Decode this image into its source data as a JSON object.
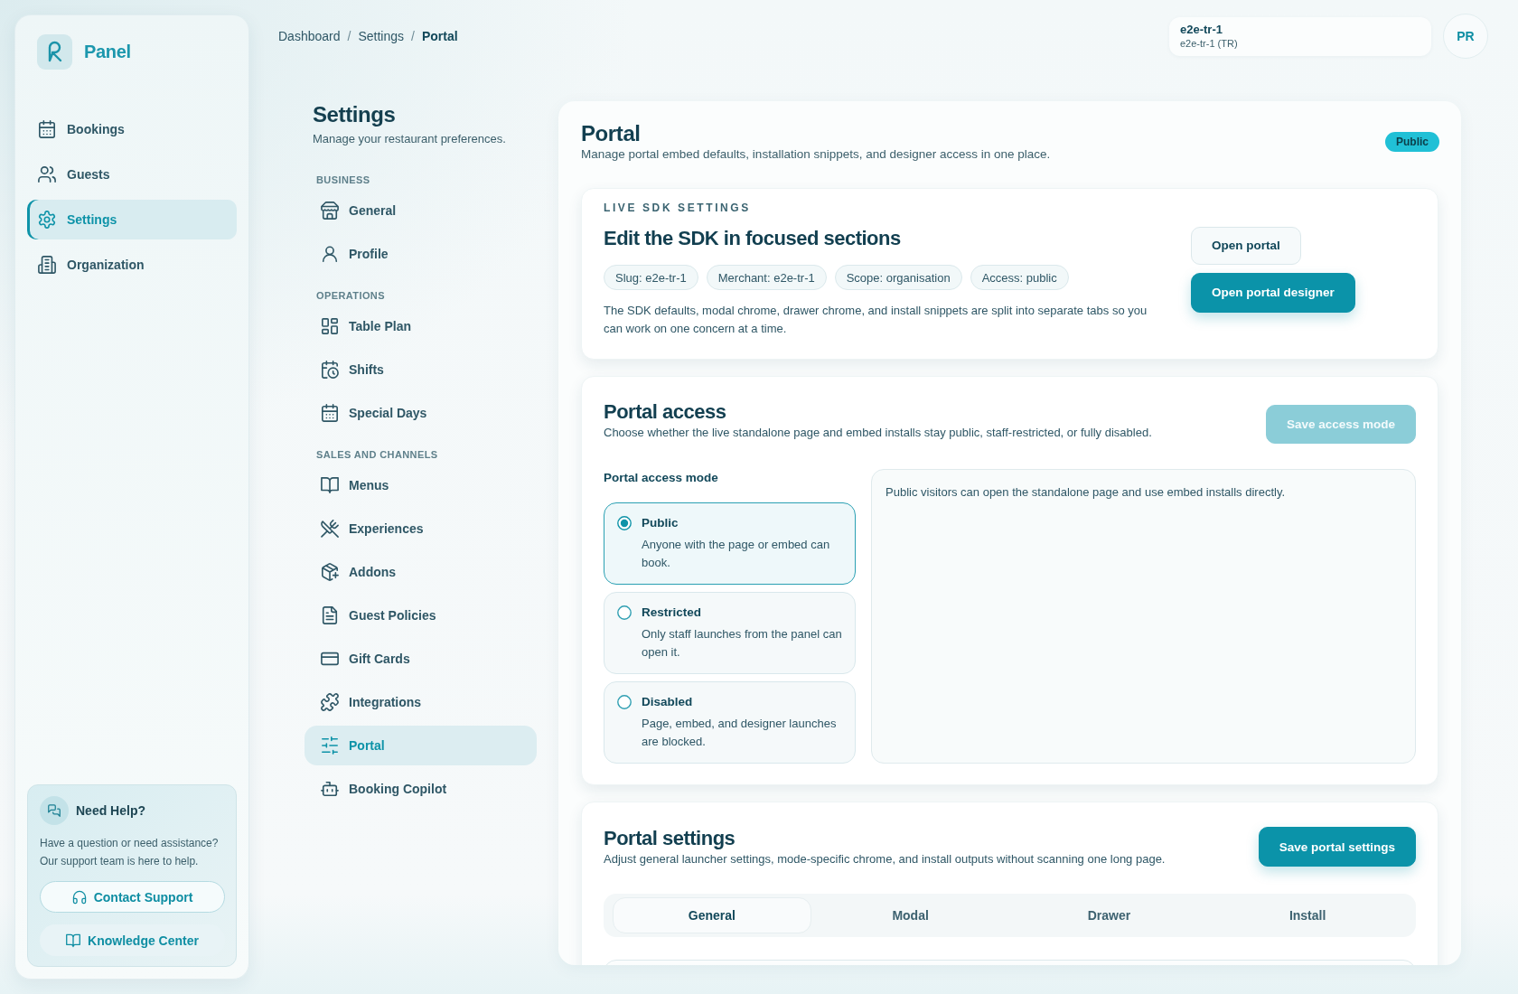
{
  "sidebar": {
    "brand": "Panel",
    "nav": [
      {
        "label": "Bookings",
        "selected": false
      },
      {
        "label": "Guests",
        "selected": false
      },
      {
        "label": "Settings",
        "selected": true
      },
      {
        "label": "Organization",
        "selected": false
      }
    ],
    "help": {
      "title": "Need Help?",
      "text_lines": [
        "Have a question or need assistance?",
        "Our support team is here to help."
      ],
      "buttons": [
        {
          "label": "Contact Support",
          "kind": "outline"
        },
        {
          "label": "Knowledge Center",
          "kind": "soft"
        }
      ]
    }
  },
  "breadcrumb": {
    "separator": "/",
    "items": [
      {
        "label": "Dashboard",
        "current": false
      },
      {
        "label": "Settings",
        "current": false
      },
      {
        "label": "Portal",
        "current": true
      }
    ]
  },
  "account": {
    "name": "e2e-tr-1",
    "detail": "e2e-tr-1 (TR)",
    "initials": "PR"
  },
  "settings_nav": {
    "title": "Settings",
    "subtitle": "Manage your restaurant preferences.",
    "groups": [
      {
        "heading": "BUSINESS",
        "items": [
          {
            "label": "General",
            "selected": false
          },
          {
            "label": "Profile",
            "selected": false
          }
        ]
      },
      {
        "heading": "OPERATIONS",
        "items": [
          {
            "label": "Table Plan",
            "selected": false
          },
          {
            "label": "Shifts",
            "selected": false
          },
          {
            "label": "Special Days",
            "selected": false
          }
        ]
      },
      {
        "heading": "SALES AND CHANNELS",
        "items": [
          {
            "label": "Menus",
            "selected": false
          },
          {
            "label": "Experiences",
            "selected": false
          },
          {
            "label": "Addons",
            "selected": false
          },
          {
            "label": "Guest Policies",
            "selected": false
          },
          {
            "label": "Gift Cards",
            "selected": false
          },
          {
            "label": "Integrations",
            "selected": false
          },
          {
            "label": "Portal",
            "selected": true
          },
          {
            "label": "Booking Copilot",
            "selected": false
          }
        ]
      }
    ]
  },
  "portal": {
    "title": "Portal",
    "description": "Manage portal embed defaults, installation snippets, and designer access in one place.",
    "badge": "Public",
    "sdk": {
      "eyebrow": "LIVE SDK SETTINGS",
      "title": "Edit the SDK in focused sections",
      "chips": [
        "Slug: e2e-tr-1",
        "Merchant: e2e-tr-1",
        "Scope: organisation",
        "Access: public"
      ],
      "description": "The SDK defaults, modal chrome, drawer chrome, and install snippets are split into separate tabs so you can work on one concern at a time.",
      "buttons": [
        {
          "label": "Open portal",
          "kind": "secondary"
        },
        {
          "label": "Open portal designer",
          "kind": "primary"
        }
      ]
    },
    "access": {
      "title": "Portal access",
      "description": "Choose whether the live standalone page and embed installs stay public, staff-restricted, or fully disabled.",
      "save_button": {
        "label": "Save access mode",
        "disabled": true
      },
      "mode_label": "Portal access mode",
      "options": [
        {
          "title": "Public",
          "description": "Anyone with the page or embed can book.",
          "selected": true
        },
        {
          "title": "Restricted",
          "description": "Only staff launches from the panel can open it.",
          "selected": false
        },
        {
          "title": "Disabled",
          "description": "Page, embed, and designer launches are blocked.",
          "selected": false
        }
      ],
      "info": "Public visitors can open the standalone page and use embed installs directly."
    },
    "settings": {
      "title": "Portal settings",
      "description": "Adjust general launcher settings, mode-specific chrome, and install outputs without scanning one long page.",
      "save_button": {
        "label": "Save portal settings",
        "disabled": false
      },
      "tabs": [
        {
          "label": "General",
          "selected": true
        },
        {
          "label": "Modal",
          "selected": false
        },
        {
          "label": "Drawer",
          "selected": false
        },
        {
          "label": "Install",
          "selected": false
        }
      ]
    }
  }
}
